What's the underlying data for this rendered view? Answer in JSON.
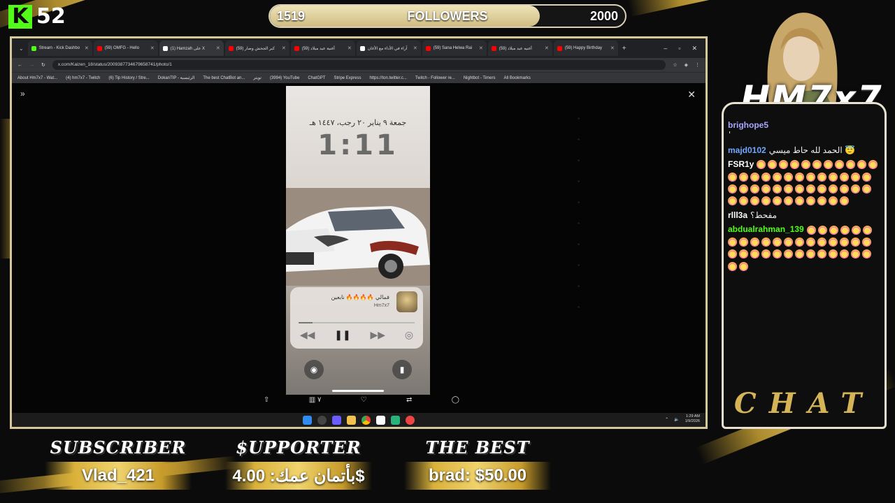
{
  "kick": {
    "logo": "K",
    "count": "52"
  },
  "followers_goal": {
    "current": "1519",
    "label": "FOLLOWERS",
    "target": "2000",
    "progress": 0.76
  },
  "browser": {
    "tabs": [
      {
        "label": "Stream - Kick Dashbo",
        "favicon_color": "#53fc18",
        "active": false
      },
      {
        "label": "(59) OMFG - Hello",
        "favicon_color": "#ff0000",
        "active": false
      },
      {
        "label": "(1) Hamzah على X",
        "favicon_color": "#ffffff",
        "active": true
      },
      {
        "label": "(59) كبر الجحش وصار",
        "favicon_color": "#ff0000",
        "active": false
      },
      {
        "label": "(59) أغنية عيد ميلاد",
        "favicon_color": "#ff0000",
        "active": false
      },
      {
        "label": "آراء في الأداء مع الأغان",
        "favicon_color": "#ffffff",
        "active": false
      },
      {
        "label": "(59) Sana Helwa Rai",
        "favicon_color": "#ff0000",
        "active": false
      },
      {
        "label": "(59) أغنيه عيد ميلاد",
        "favicon_color": "#ff0000",
        "active": false
      },
      {
        "label": "(59) Happy Birthday",
        "favicon_color": "#ff0000",
        "active": false
      }
    ],
    "url": "x.com/Kaizen_18/status/2009387734679658741/photo/1",
    "bookmarks": [
      "About Hm7x7 - Wat...",
      "(4) hm7x7 - Twitch",
      "(6) Tip History / Stre...",
      "DokanTIP - الرئيسية",
      "The best ChatBot an...",
      "تويتر",
      "(3994) YouTube",
      "ChatGPT",
      "Stripe Express",
      "https://ton.twitter.c...",
      "Twitch - Follower re...",
      "Nightbot - Timers",
      "All Bookmarks"
    ]
  },
  "phone": {
    "date": "جمعة ٩ يناير ٢٠ رجب، ١٤٤٧ هـ",
    "time": "1:11",
    "player": {
      "title": "فمالي 🔥🔥🔥🔥 نابعين",
      "artist": "Hm7x7"
    }
  },
  "taskbar": {
    "time": "1:29 AM",
    "date": "1/9/2026"
  },
  "channel_name": "HM7x7",
  "chat": {
    "messages": [
      {
        "user": "brighope5",
        "color": "#a7a7ff",
        "text": "",
        "wall": "ٰٰٰٰٰٰٰٰٰٰٰٰٰٰٰٰٰٰٰٰٰٰٰٰٰٰٰٰٰٰٰٰٰٰٰٰٰٰٰٰٰٰٰٰٰٰٰٰٰٰٰٰٰٰٰٰٰٰٰٰٰٰٰٰٰٰٰٰٰٰٰٰٰٰٰٰٰٰٰٰٰٰٰٰٰٰٰٰٰٰٰٰ"
      },
      {
        "user": "majd0102",
        "color": "#6fa8ff",
        "text": "الحمد لله حاط ميسي 😇",
        "emotes": 0
      },
      {
        "user": "FSR1y",
        "color": "#ffffff",
        "text": "",
        "emotes": 48
      },
      {
        "user": "rlll3a",
        "color": "#ffffff",
        "text": "مفحط؟",
        "emotes": 0
      },
      {
        "user": "abdualrahman_139",
        "color": "#53fc18",
        "text": "",
        "emotes": 34
      }
    ],
    "label": "CHAT"
  },
  "bottom": {
    "subscriber": {
      "title": "SUBSCRIBER",
      "value": "Vlad_421"
    },
    "supporter": {
      "title": "$UPPORTER",
      "value": "بأتمان عمك: 4.00$"
    },
    "best": {
      "title": "THE BEST",
      "value": "brad: $50.00"
    }
  }
}
